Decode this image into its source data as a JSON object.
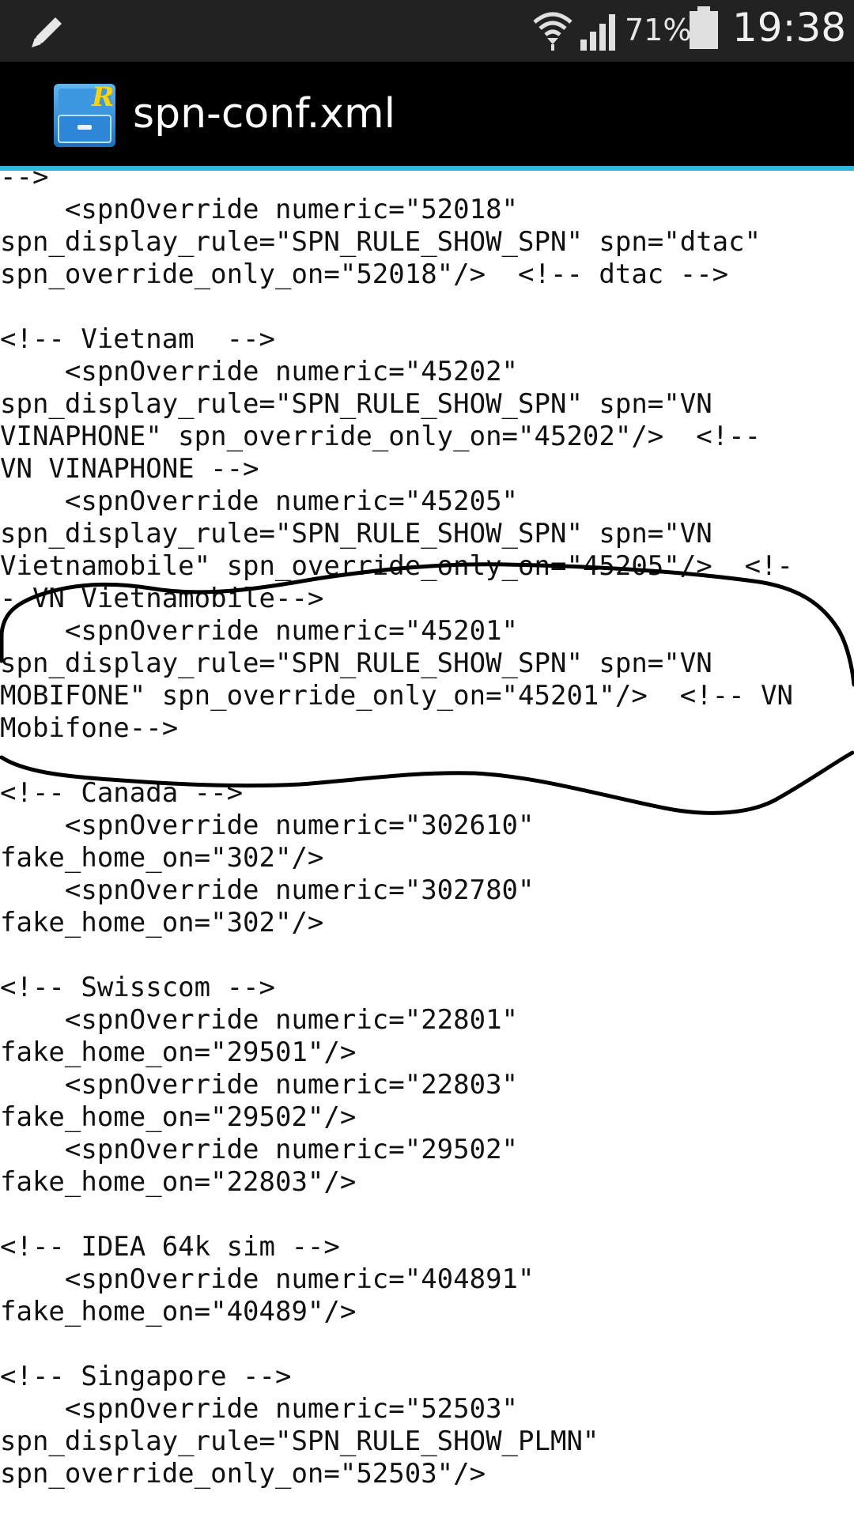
{
  "status_bar": {
    "left_icon": "pencil-icon",
    "wifi_icon": "wifi-icon",
    "signal_icon": "cell-signal-icon",
    "battery_percent": "71%",
    "battery_icon": "battery-icon",
    "time": "19:38"
  },
  "action_bar": {
    "app_icon": "root-explorer-icon",
    "title": "spn-conf.xml"
  },
  "editor": {
    "lines": [
      "-->",
      "    <spnOverride numeric=\"52018\"",
      "spn_display_rule=\"SPN_RULE_SHOW_SPN\" spn=\"dtac\"",
      "spn_override_only_on=\"52018\"/>  <!-- dtac -->",
      "",
      "<!-- Vietnam  -->",
      "    <spnOverride numeric=\"45202\"",
      "spn_display_rule=\"SPN_RULE_SHOW_SPN\" spn=\"VN",
      "VINAPHONE\" spn_override_only_on=\"45202\"/>  <!--",
      "VN VINAPHONE -->",
      "    <spnOverride numeric=\"45205\"",
      "spn_display_rule=\"SPN_RULE_SHOW_SPN\" spn=\"VN",
      "Vietnamobile\" spn_override_only_on=\"45205\"/>  <!-",
      "- VN Vietnamobile-->",
      "    <spnOverride numeric=\"45201\"",
      "spn_display_rule=\"SPN_RULE_SHOW_SPN\" spn=\"VN",
      "MOBIFONE\" spn_override_only_on=\"45201\"/>  <!-- VN",
      "Mobifone-->",
      "",
      "<!-- Canada -->",
      "    <spnOverride numeric=\"302610\"",
      "fake_home_on=\"302\"/>",
      "    <spnOverride numeric=\"302780\"",
      "fake_home_on=\"302\"/>",
      "",
      "<!-- Swisscom -->",
      "    <spnOverride numeric=\"22801\"",
      "fake_home_on=\"29501\"/>",
      "    <spnOverride numeric=\"22803\"",
      "fake_home_on=\"29502\"/>",
      "    <spnOverride numeric=\"29502\"",
      "fake_home_on=\"22803\"/>",
      "",
      "<!-- IDEA 64k sim -->",
      "    <spnOverride numeric=\"404891\"",
      "fake_home_on=\"40489\"/>",
      "",
      "<!-- Singapore -->",
      "    <spnOverride numeric=\"52503\"",
      "spn_display_rule=\"SPN_RULE_SHOW_PLMN\"",
      "spn_override_only_on=\"52503\"/>"
    ]
  },
  "annotation": {
    "type": "hand-drawn-circle-icon",
    "color": "#000000"
  }
}
